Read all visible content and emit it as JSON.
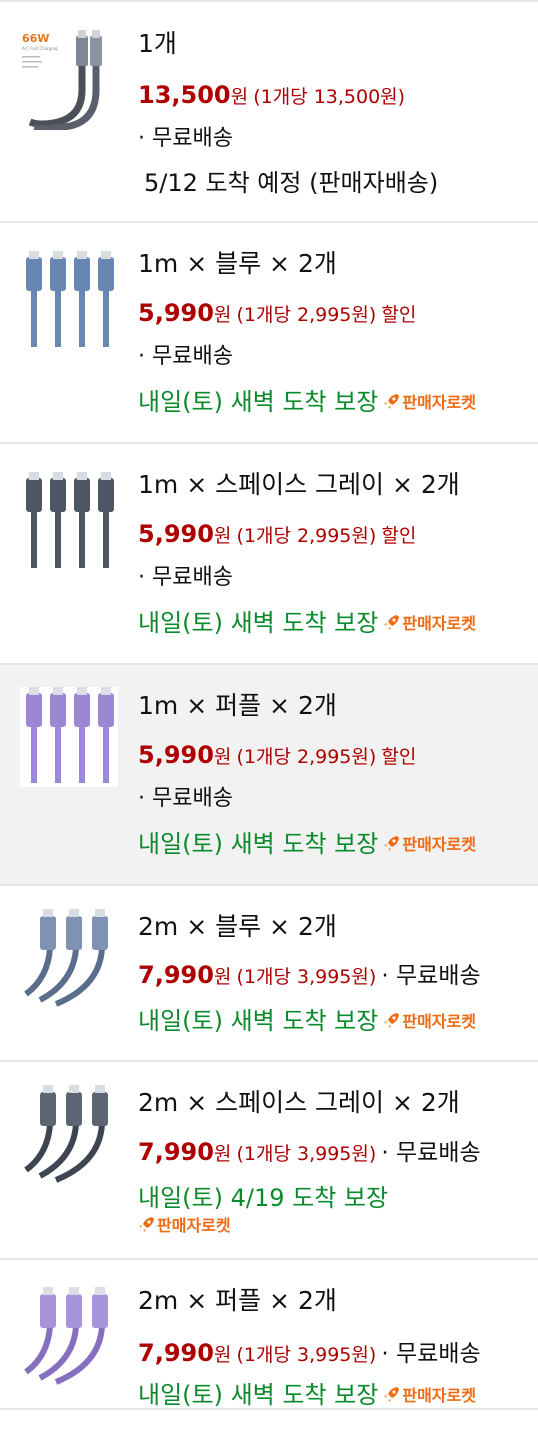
{
  "options": [
    {
      "name": "1개",
      "thumb_badge": "66W",
      "thumb_caption": "A-C Fast Charging",
      "price": "13,500",
      "won": "원",
      "unit_price": "(1개당 13,500원)",
      "discount": "",
      "shipping": "· 무료배송",
      "eta": "5/12 도착 예정 (판매자배송)",
      "eta_style": "normal",
      "badge": "",
      "cable_color": "#4a4f5a"
    },
    {
      "name": "1m × 블루 × 2개",
      "price": "5,990",
      "won": "원",
      "unit_price": "(1개당 2,995원)",
      "discount": "할인",
      "shipping": "· 무료배송",
      "eta": "내일(토) 새벽 도착 보장",
      "eta_style": "green",
      "badge": "판매자로켓",
      "cable_color": "#6a86b3"
    },
    {
      "name": "1m × 스페이스 그레이 × 2개",
      "price": "5,990",
      "won": "원",
      "unit_price": "(1개당 2,995원)",
      "discount": "할인",
      "shipping": "· 무료배송",
      "eta": "내일(토) 새벽 도착 보장",
      "eta_style": "green",
      "badge": "판매자로켓",
      "cable_color": "#4e5663"
    },
    {
      "name": "1m × 퍼플 × 2개",
      "price": "5,990",
      "won": "원",
      "unit_price": "(1개당 2,995원)",
      "discount": "할인",
      "shipping": "· 무료배송",
      "eta": "내일(토) 새벽 도착 보장",
      "eta_style": "green",
      "badge": "판매자로켓",
      "cable_color": "#9c86d6",
      "selected": true
    },
    {
      "name": "2m × 블루 × 2개",
      "price": "7,990",
      "won": "원",
      "unit_price": "(1개당 3,995원)",
      "shipping_inline": "· 무료배송",
      "eta": "내일(토) 새벽 도착 보장",
      "eta_style": "green",
      "badge": "판매자로켓",
      "cable_color": "#5b6d8c"
    },
    {
      "name": "2m × 스페이스 그레이 × 2개",
      "price": "7,990",
      "won": "원",
      "unit_price": "(1개당 3,995원)",
      "shipping_inline": "· 무료배송",
      "eta": "내일(토) 4/19 도착 보장",
      "eta_style": "green",
      "badge": "판매자로켓",
      "cable_color": "#3f4550"
    },
    {
      "name": "2m × 퍼플 × 2개",
      "price": "7,990",
      "won": "원",
      "unit_price": "(1개당 3,995원)",
      "shipping_inline": "· 무료배송",
      "eta": "내일(토) 새벽 도착 보장",
      "eta_style": "green",
      "badge": "판매자로켓",
      "cable_color": "#8570bf"
    }
  ],
  "colors": {
    "price_red": "#ae0000",
    "eta_green": "#0b8a2d",
    "rocket_orange": "#ee6a13",
    "selected_bg": "#f2f2f2",
    "divider": "#e6e6e6"
  },
  "icons": {
    "rocket": "rocket-icon"
  }
}
